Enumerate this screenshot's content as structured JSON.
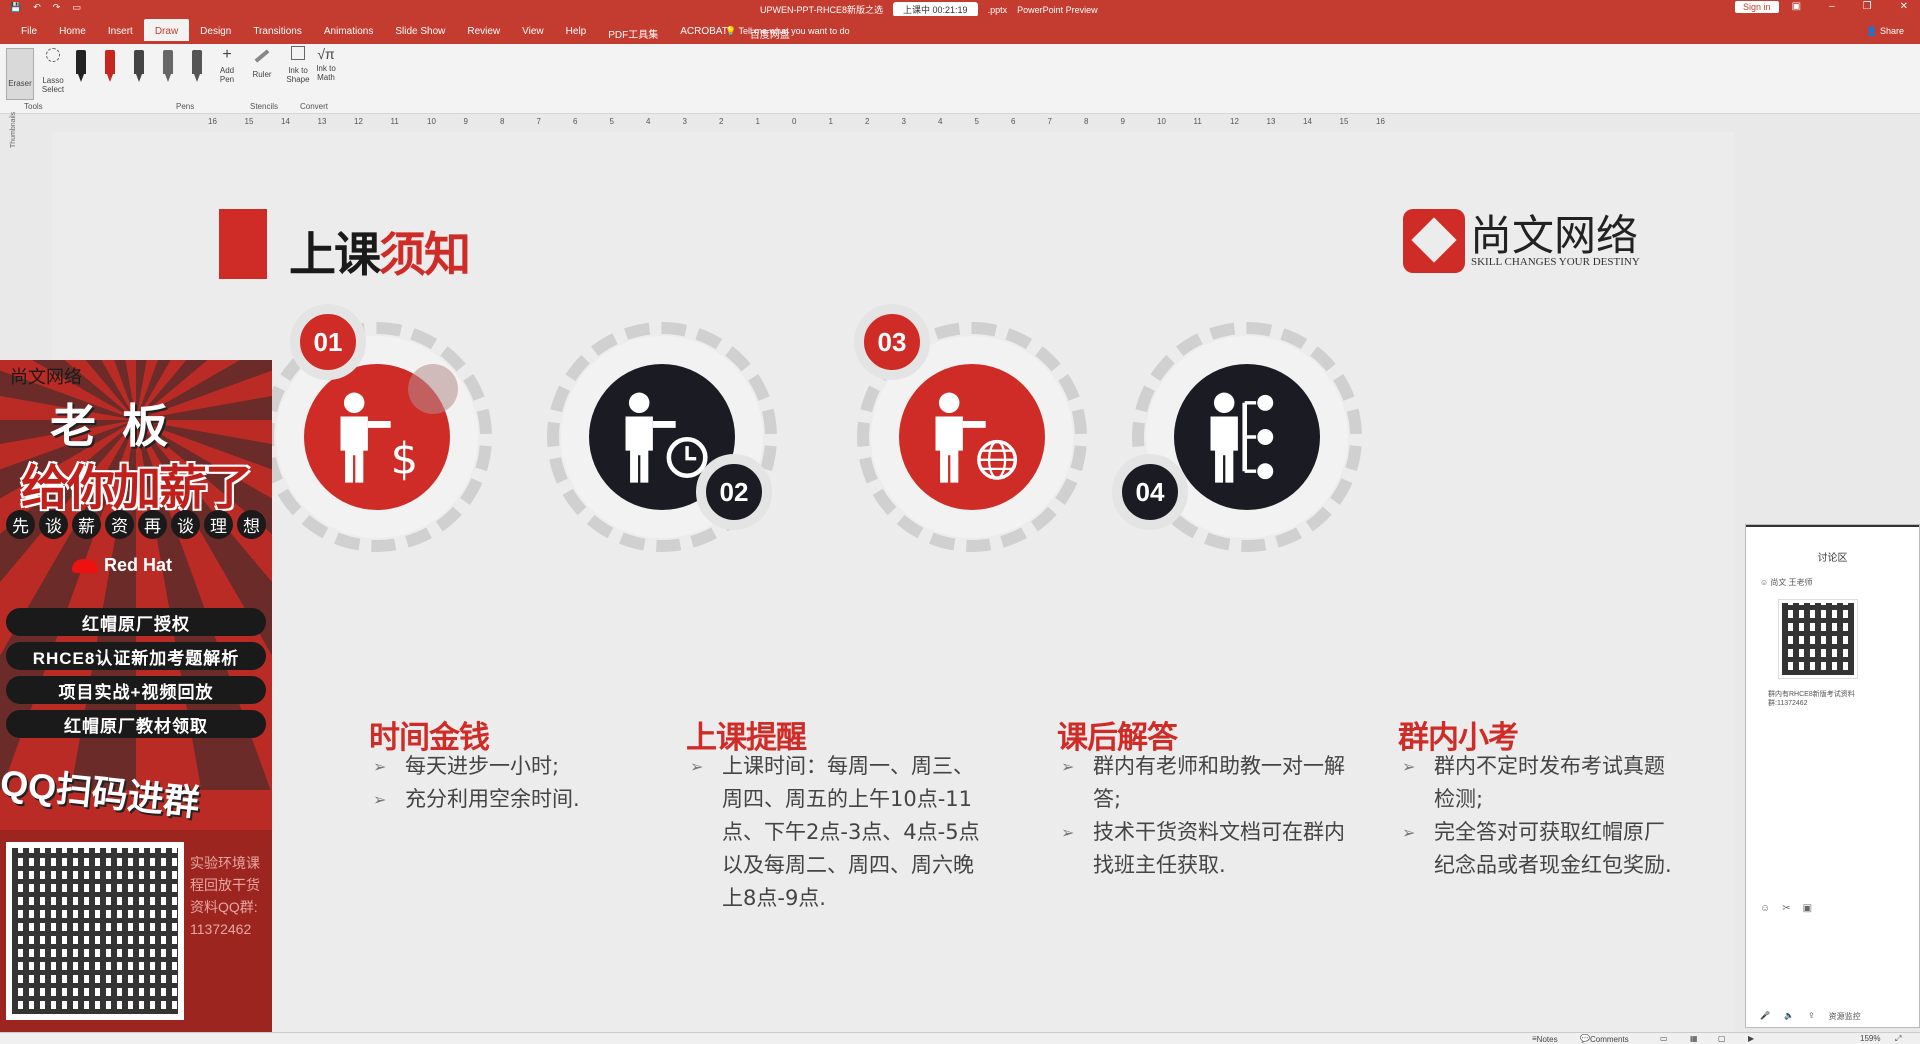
{
  "window": {
    "doc_title": "UPWEN-PPT-RHCE8新版之选",
    "recording": "上课中 00:21:19",
    "file_suffix": ".pptx",
    "app_preview": "PowerPoint Preview",
    "signin_label": "Sign in"
  },
  "tabs": [
    "File",
    "Home",
    "Insert",
    "Draw",
    "Design",
    "Transitions",
    "Animations",
    "Slide Show",
    "Review",
    "View",
    "Help",
    "PDF工具集",
    "ACROBAT",
    "百度网盘"
  ],
  "tell_me": "Tell me what you want to do",
  "share_label": "Share",
  "ribbon": {
    "eraser": "Eraser",
    "lasso": "Lasso Select",
    "add_pen": "Add Pen",
    "ruler": "Ruler",
    "ink_to_shape": "Ink to Shape",
    "ink_to_math": "Ink to Math",
    "group_tools": "Tools",
    "group_pens": "Pens",
    "group_stencils": "Stencils",
    "group_convert": "Convert",
    "pen_colors": [
      "#222222",
      "#c8251f",
      "#444444",
      "#666666",
      "#555555"
    ]
  },
  "ruler_ticks": [
    "16",
    "15",
    "14",
    "13",
    "12",
    "11",
    "10",
    "9",
    "8",
    "7",
    "6",
    "5",
    "4",
    "3",
    "2",
    "1",
    "0",
    "1",
    "2",
    "3",
    "4",
    "5",
    "6",
    "7",
    "8",
    "9",
    "10",
    "11",
    "12",
    "13",
    "14",
    "15",
    "16"
  ],
  "thumbnails_label": "Thumbnails",
  "slide": {
    "title_black": "上课",
    "title_red": "须知",
    "logo_cn": "尚文网络",
    "logo_en": "SKILL CHANGES YOUR DESTINY",
    "columns": [
      {
        "num": "01",
        "heading": "时间金钱",
        "items": [
          "每天进步一小时;",
          "充分利用空余时间."
        ]
      },
      {
        "num": "02",
        "heading": "上课提醒",
        "items": [
          "上课时间：每周一、周三、周四、周五的上午10点-11点、下午2点-3点、4点-5点以及每周二、周四、周六晚上8点-9点."
        ]
      },
      {
        "num": "03",
        "heading": "课后解答",
        "items": [
          "群内有老师和助教一对一解答;",
          "技术干货资料文档可在群内找班主任获取."
        ]
      },
      {
        "num": "04",
        "heading": "群内小考",
        "items": [
          "群内不定时发布考试真题检测;",
          "完全答对可获取红帽原厂纪念品或者现金红包奖励."
        ]
      }
    ],
    "accent": "#d02c27",
    "dark": "#1b1b24"
  },
  "ad": {
    "brand": "尚文网络",
    "line1": "老板",
    "line2": "给你加薪了",
    "dots": [
      "先",
      "谈",
      "薪",
      "资",
      "再",
      "谈",
      "理",
      "想"
    ],
    "redhat": "Red Hat",
    "pills": [
      "红帽原厂授权",
      "RHCE8认证新加考题解析",
      "项目实战+视频回放",
      "红帽原厂教材领取"
    ],
    "qq": "QQ扫码进群",
    "side_text": "实验环境课程回放干货资料QQ群:11372462"
  },
  "chat": {
    "title": "讨论区",
    "user": "尚文 王老师",
    "message": "群内有RHCE8新版考试资料 群:11372462",
    "footer": "资源监控"
  },
  "status": {
    "notes": "Notes",
    "comments": "Comments",
    "zoom": "159%"
  }
}
